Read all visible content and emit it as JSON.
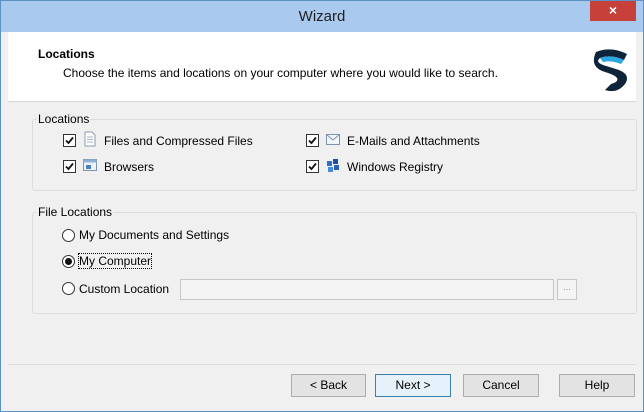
{
  "window": {
    "title": "Wizard",
    "close_label": "×"
  },
  "header": {
    "title": "Locations",
    "subtitle": "Choose the items and locations on your computer where you would like to search."
  },
  "locations": {
    "group_label": "Locations",
    "items": [
      {
        "label": "Files and Compressed Files",
        "checked": true,
        "icon": "file-icon"
      },
      {
        "label": "E-Mails and Attachments",
        "checked": true,
        "icon": "email-icon"
      },
      {
        "label": "Browsers",
        "checked": true,
        "icon": "browser-icon"
      },
      {
        "label": "Windows Registry",
        "checked": true,
        "icon": "registry-icon"
      }
    ]
  },
  "file_locations": {
    "group_label": "File Locations",
    "options": [
      {
        "label": "My Documents and Settings",
        "selected": false
      },
      {
        "label": "My Computer",
        "selected": true
      },
      {
        "label": "Custom Location",
        "selected": false
      }
    ],
    "custom_path_value": "",
    "browse_label": "..."
  },
  "footer": {
    "back_label": "< Back",
    "next_label": "Next >",
    "cancel_label": "Cancel",
    "help_label": "Help"
  },
  "colors": {
    "titlebar": "#a9c9ee",
    "close": "#c7403a",
    "logo_dark": "#0f2438",
    "logo_accent": "#2aa7e0"
  }
}
